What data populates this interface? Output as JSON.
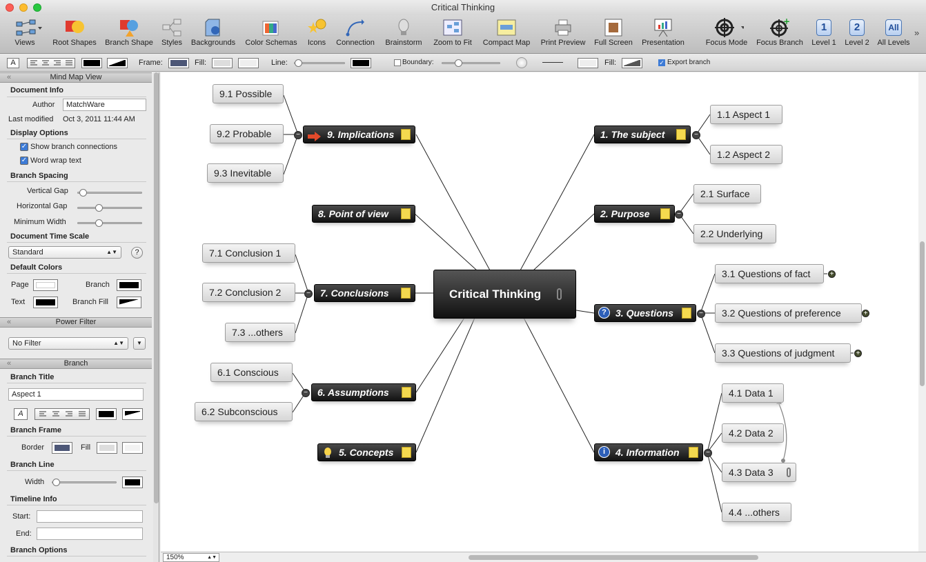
{
  "window": {
    "title": "Critical Thinking"
  },
  "toolbar": {
    "items": [
      "Views",
      "Root Shapes",
      "Branch Shape",
      "Styles",
      "Backgrounds",
      "Color Schemas",
      "Icons",
      "Connection",
      "Brainstorm",
      "Zoom to Fit",
      "Compact Map",
      "Print Preview",
      "Full Screen",
      "Presentation",
      "Focus Mode",
      "Focus Branch",
      "Level 1",
      "Level 2",
      "All Levels"
    ],
    "level1_glyph": "1",
    "level2_glyph": "2",
    "all_glyph": "All"
  },
  "formatbar": {
    "text_btn": "A",
    "frame_label": "Frame:",
    "fill_label": "Fill:",
    "line_label": "Line:",
    "boundary_label": "Boundary:",
    "fill2_label": "Fill:",
    "export_label": "Export branch"
  },
  "sidebar": {
    "mindmap_header": "Mind Map View",
    "document_info": "Document Info",
    "author_label": "Author",
    "author_value": "MatchWare",
    "modified_label": "Last modified",
    "modified_value": "Oct 3, 2011 11:44 AM",
    "display_options": "Display Options",
    "show_connections": "Show branch connections",
    "word_wrap": "Word wrap text",
    "branch_spacing": "Branch Spacing",
    "vertical_gap": "Vertical Gap",
    "horizontal_gap": "Horizontal Gap",
    "minimum_width": "Minimum Width",
    "time_scale": "Document Time Scale",
    "time_scale_value": "Standard",
    "help": "?",
    "default_colors": "Default Colors",
    "page_label": "Page",
    "branch_label": "Branch",
    "text_label": "Text",
    "branch_fill_label": "Branch Fill",
    "power_filter_header": "Power Filter",
    "filter_value": "No Filter",
    "branch_header": "Branch",
    "branch_title": "Branch Title",
    "branch_title_value": "Aspect 1",
    "branch_frame": "Branch Frame",
    "border_label": "Border",
    "fill_label": "Fill",
    "branch_line": "Branch Line",
    "width_label": "Width",
    "timeline_info": "Timeline Info",
    "start_label": "Start:",
    "end_label": "End:",
    "branch_options": "Branch Options"
  },
  "map": {
    "center": "Critical Thinking",
    "branches": [
      {
        "label": "1.  The subject",
        "children": [
          "1.1  Aspect 1",
          "1.2  Aspect 2"
        ]
      },
      {
        "label": "2.  Purpose",
        "children": [
          "2.1  Surface",
          "2.2  Underlying"
        ]
      },
      {
        "label": "3.  Questions",
        "children": [
          "3.1  Questions of fact",
          "3.2  Questions of preference",
          "3.3  Questions of judgment"
        ]
      },
      {
        "label": "4.  Information",
        "children": [
          "4.1  Data 1",
          "4.2  Data 2",
          "4.3  Data 3",
          "4.4  ...others"
        ]
      },
      {
        "label": "5.  Concepts",
        "children": []
      },
      {
        "label": "6.  Assumptions",
        "children": [
          "6.1  Conscious",
          "6.2  Subconscious"
        ]
      },
      {
        "label": "7.  Conclusions",
        "children": [
          "7.1  Conclusion 1",
          "7.2  Conclusion 2",
          "7.3  ...others"
        ]
      },
      {
        "label": "8.  Point of view",
        "children": []
      },
      {
        "label": "9.  Implications",
        "children": [
          "9.1  Possible",
          "9.2  Probable",
          "9.3  Inevitable"
        ]
      }
    ],
    "question_glyph": "?",
    "info_glyph": "i",
    "collapse_glyph": "−",
    "expand_glyph": "+"
  },
  "statusbar": {
    "zoom": "150%"
  },
  "colors": {
    "accent": "#3d7bd6",
    "node_dark": "#1a1a1a",
    "note": "#f4d94f"
  }
}
